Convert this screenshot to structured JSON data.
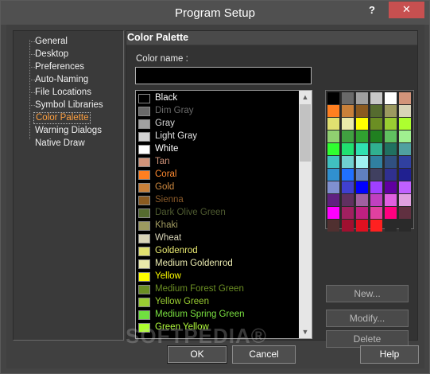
{
  "window": {
    "title": "Program Setup",
    "help_glyph": "?",
    "close_glyph": "✕"
  },
  "tree": {
    "items": [
      {
        "label": "General",
        "selected": false
      },
      {
        "label": "Desktop",
        "selected": false
      },
      {
        "label": "Preferences",
        "selected": false
      },
      {
        "label": "Auto-Naming",
        "selected": false
      },
      {
        "label": "File Locations",
        "selected": false
      },
      {
        "label": "Symbol Libraries",
        "selected": false
      },
      {
        "label": "Color Palette",
        "selected": true
      },
      {
        "label": "Warning Dialogs",
        "selected": false
      },
      {
        "label": "Native Draw",
        "selected": false
      }
    ]
  },
  "panel": {
    "title": "Color Palette",
    "color_name_label": "Color name :",
    "color_name_value": ""
  },
  "color_list": [
    {
      "name": "Black",
      "swatch": "#000000",
      "text": "#ffffff"
    },
    {
      "name": "Dim Gray",
      "swatch": "#696969",
      "text": "#6b6b6b"
    },
    {
      "name": "Gray",
      "swatch": "#a0a0a0",
      "text": "#d8d8d8"
    },
    {
      "name": "Light Gray",
      "swatch": "#d3d3d3",
      "text": "#e4e4e4"
    },
    {
      "name": "White",
      "swatch": "#ffffff",
      "text": "#ffffff"
    },
    {
      "name": "Tan",
      "swatch": "#d2947a",
      "text": "#d2947a"
    },
    {
      "name": "Coral",
      "swatch": "#ff7f20",
      "text": "#ff8a30"
    },
    {
      "name": "Gold",
      "swatch": "#c8803a",
      "text": "#d08a40"
    },
    {
      "name": "Sienna",
      "swatch": "#8a5a20",
      "text": "#8a5a2a"
    },
    {
      "name": "Dark Olive Green",
      "swatch": "#556b2f",
      "text": "#4e5a30"
    },
    {
      "name": "Khaki",
      "swatch": "#9c9a60",
      "text": "#a09a60"
    },
    {
      "name": "Wheat",
      "swatch": "#d8d4b8",
      "text": "#d8d4b8"
    },
    {
      "name": "Goldenrod",
      "swatch": "#e0e070",
      "text": "#e8e870"
    },
    {
      "name": "Medium Goldenrod",
      "swatch": "#eaeaaa",
      "text": "#eaeab0"
    },
    {
      "name": "Yellow",
      "swatch": "#ffff00",
      "text": "#ffff00"
    },
    {
      "name": "Medium Forest Green",
      "swatch": "#6b8e23",
      "text": "#6b8e23"
    },
    {
      "name": "Yellow Green",
      "swatch": "#9acd32",
      "text": "#9acd32"
    },
    {
      "name": "Medium Spring Green",
      "swatch": "#70e040",
      "text": "#7ae040"
    },
    {
      "name": "Green Yellow",
      "swatch": "#adff2f",
      "text": "#b4ff3c"
    }
  ],
  "palette": {
    "columns": 6,
    "rows": 11,
    "colors": [
      "#000000",
      "#696969",
      "#a0a0a0",
      "#c8c8c8",
      "#ffffff",
      "#d2947a",
      "#ff7f20",
      "#c8803a",
      "#8a5a20",
      "#556b2f",
      "#9c9a60",
      "#d8d4b8",
      "#e0e070",
      "#eaeaaa",
      "#ffff00",
      "#6b8e23",
      "#9acd32",
      "#adff2f",
      "#90d070",
      "#40a040",
      "#30a030",
      "#208020",
      "#60c060",
      "#a0f090",
      "#30ff30",
      "#20e070",
      "#30e0b0",
      "#30b090",
      "#207060",
      "#50a0a0",
      "#40c0c0",
      "#70d0d0",
      "#a0f0f0",
      "#3080a0",
      "#305080",
      "#3040a0",
      "#3090d0",
      "#2070ff",
      "#6080c0",
      "#404060",
      "#303090",
      "#202090",
      "#8090d0",
      "#4040d0",
      "#0000ff",
      "#a040ff",
      "#6000a0",
      "#c060ff",
      "#602080",
      "#603060",
      "#a060a0",
      "#c040c0",
      "#e060e0",
      "#e0a0e0",
      "#ff00ff",
      "#a02060",
      "#c02080",
      "#e040a0",
      "#ff0080",
      "#603040",
      "#503030",
      "#a01030",
      "#e01020",
      "#ff2020",
      "#2a2a2a",
      "#2a2a2a"
    ]
  },
  "side_buttons": {
    "new": "New...",
    "modify": "Modify...",
    "delete": "Delete"
  },
  "bottom_buttons": {
    "ok": "OK",
    "cancel": "Cancel",
    "help": "Help"
  },
  "watermark": "SOFTPEDIA®"
}
